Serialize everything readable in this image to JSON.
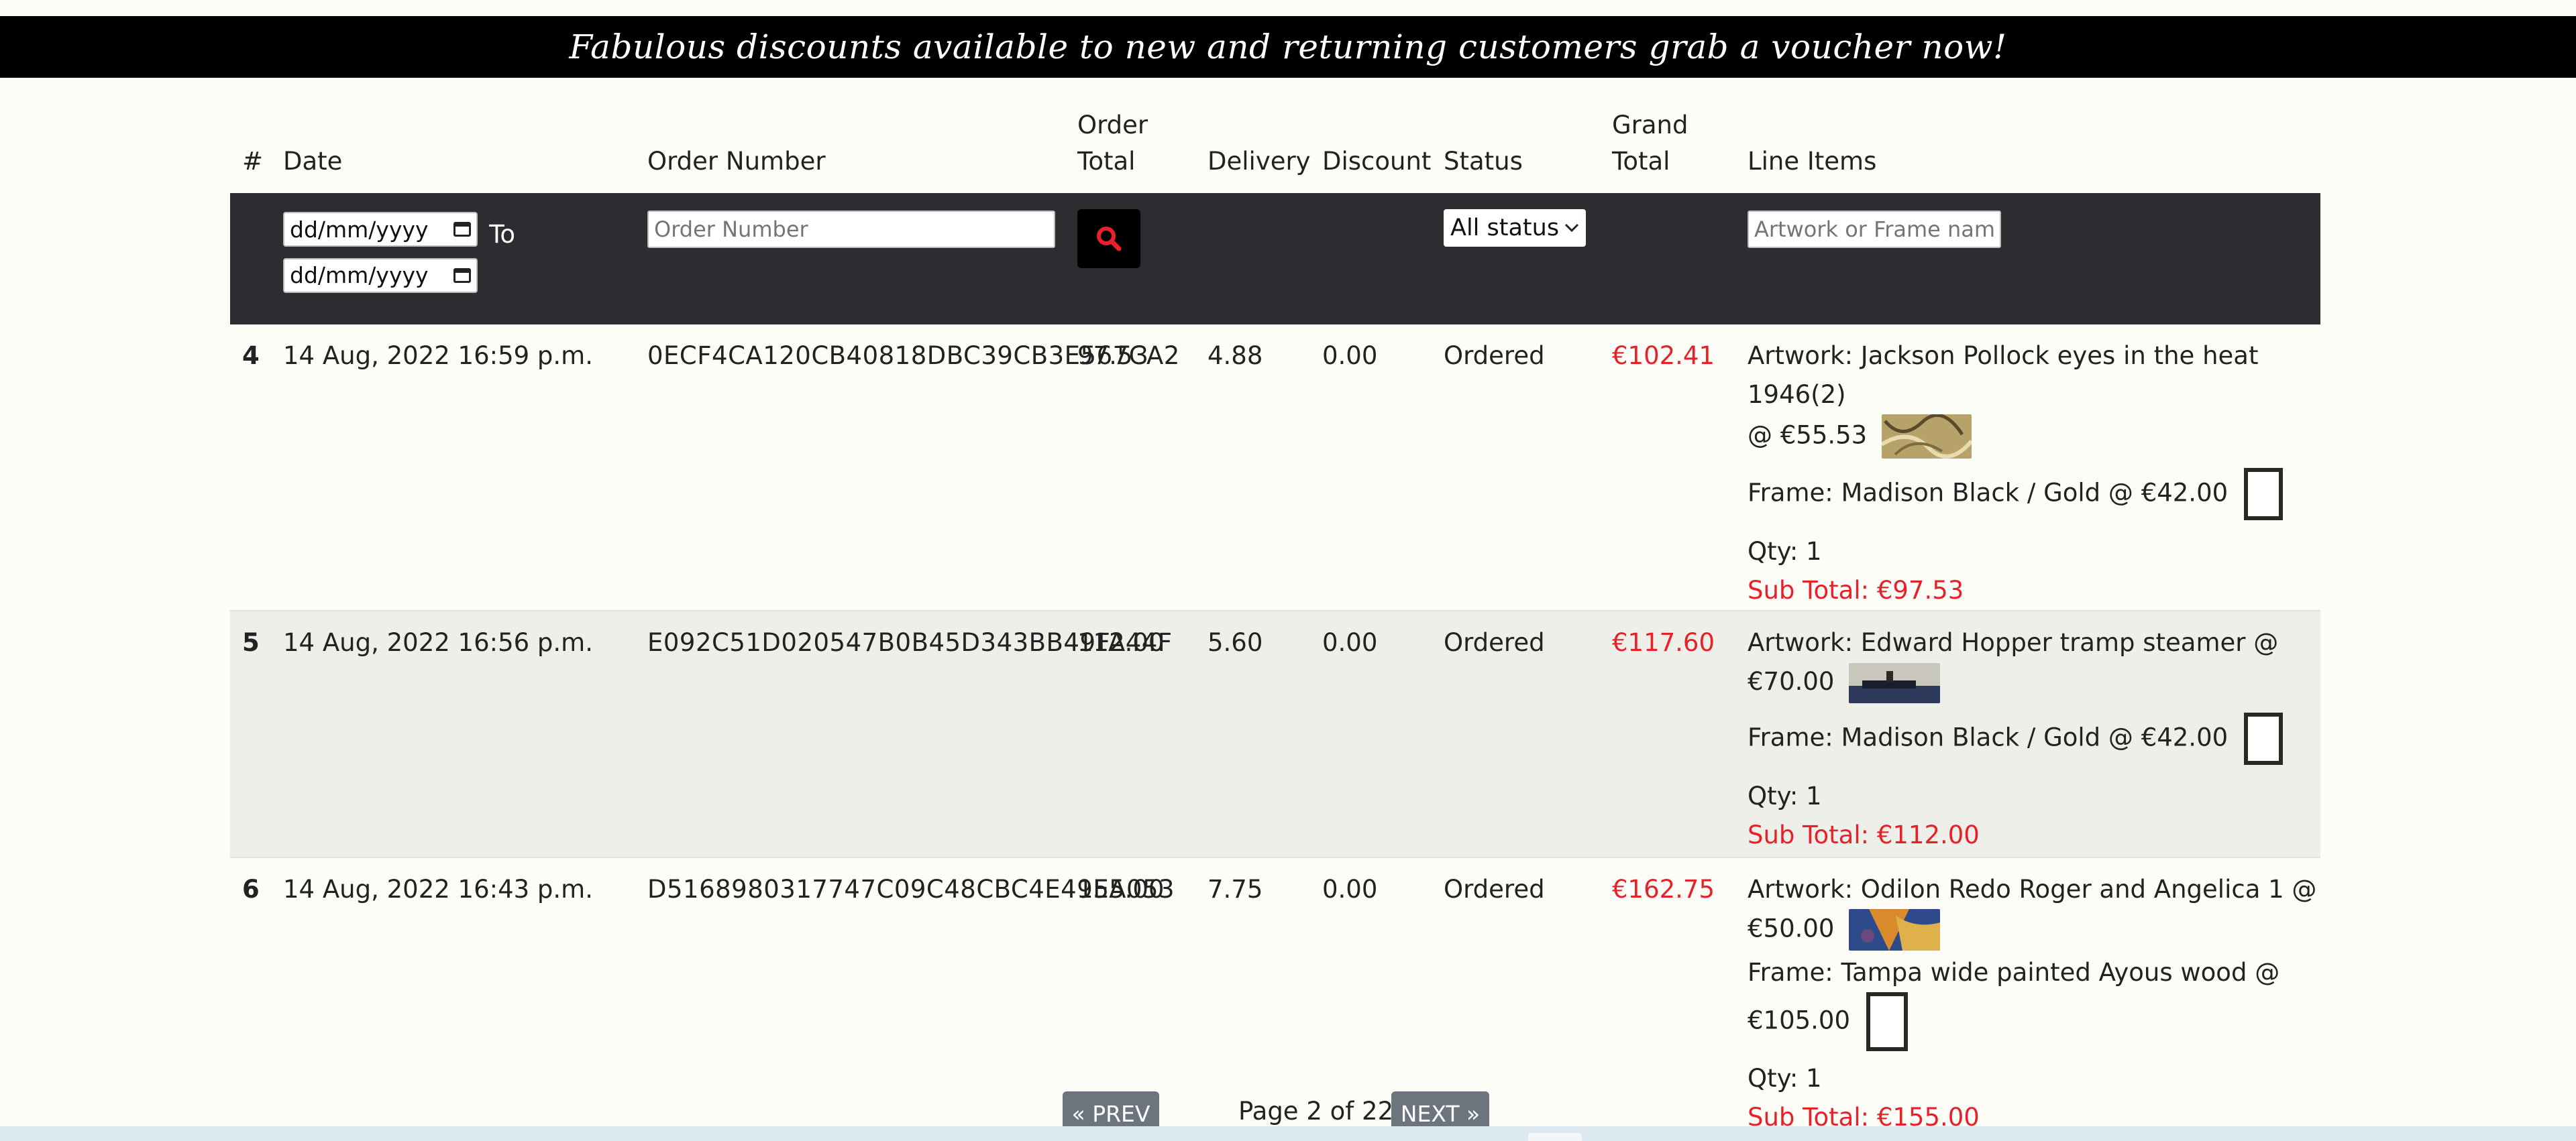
{
  "banner": {
    "text": "Fabulous discounts available to new and returning customers grab a voucher now!"
  },
  "table": {
    "headers": {
      "num": "#",
      "date": "Date",
      "order_number": "Order Number",
      "order_total": "Order Total",
      "delivery": "Delivery",
      "discount": "Discount",
      "status": "Status",
      "grand_total": "Grand Total",
      "line_items": "Line Items"
    },
    "filters": {
      "date_from_placeholder": "dd/mm/yyyy",
      "to_label": "To",
      "date_to_placeholder": "dd/mm/yyyy",
      "order_number_placeholder": "Order Number",
      "status_selected": "All status",
      "line_items_placeholder": "Artwork or Frame name"
    },
    "rows": [
      {
        "num": "4",
        "date": "14 Aug, 2022 16:59 p.m.",
        "order_number": "0ECF4CA120CB40818DBC39CB3E567CA2",
        "order_total": "97.53",
        "delivery": "4.88",
        "discount": "0.00",
        "status": "Ordered",
        "grand_total": "€102.41",
        "artwork_a": "Artwork: Jackson Pollock eyes in the heat 1946(2)",
        "artwork_b": "@ €55.53",
        "frame_a": "Frame: Madison Black / Gold @ €42.00",
        "frame_b": "",
        "qty": "Qty: 1",
        "subtotal": "Sub Total: €97.53"
      },
      {
        "num": "5",
        "date": "14 Aug, 2022 16:56 p.m.",
        "order_number": "E092C51D020547B0B45D343BB49FA44F",
        "order_total": "112.00",
        "delivery": "5.60",
        "discount": "0.00",
        "status": "Ordered",
        "grand_total": "€117.60",
        "artwork_a": "Artwork: Edward Hopper tramp steamer @",
        "artwork_b": "€70.00",
        "frame_a": "Frame: Madison Black / Gold @ €42.00",
        "frame_b": "",
        "qty": "Qty: 1",
        "subtotal": "Sub Total: €112.00"
      },
      {
        "num": "6",
        "date": "14 Aug, 2022 16:43 p.m.",
        "order_number": "D5168980317747C09C48CBC4E49EA053",
        "order_total": "155.00",
        "delivery": "7.75",
        "discount": "0.00",
        "status": "Ordered",
        "grand_total": "€162.75",
        "artwork_a": "Artwork: Odilon Redo Roger and Angelica 1 @",
        "artwork_b": "€50.00",
        "frame_a": "Frame: Tampa wide painted Ayous wood @",
        "frame_b": "€105.00",
        "qty": "Qty: 1",
        "subtotal": "Sub Total: €155.00"
      }
    ]
  },
  "pagination": {
    "prev": "« PREV",
    "page_text": "Page 2 of 22",
    "next": "NEXT »"
  },
  "colors": {
    "accent_red": "#e8202a",
    "filter_bar": "#2b2d31",
    "pager_button": "#6c757d"
  }
}
